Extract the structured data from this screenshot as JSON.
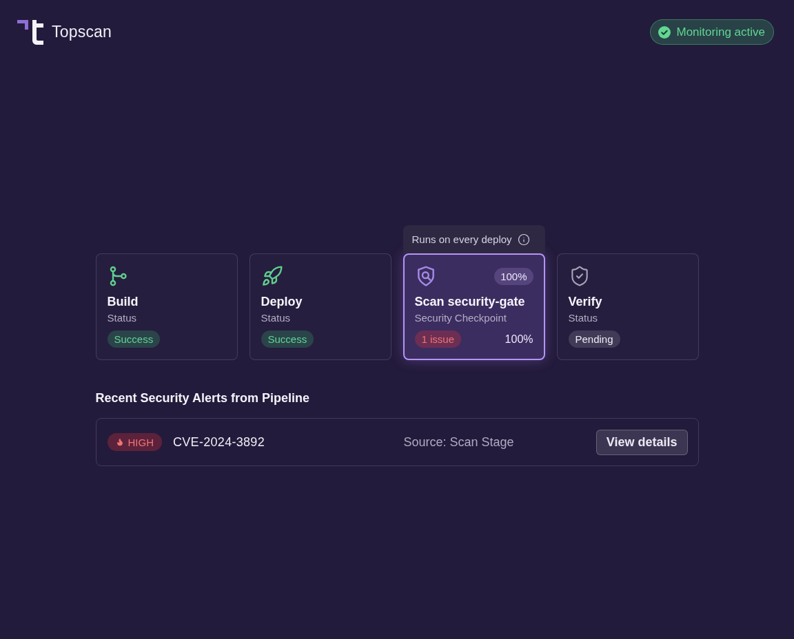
{
  "header": {
    "brand": "Topscan",
    "status": {
      "label": "Monitoring active",
      "kind": "success"
    }
  },
  "pipeline": {
    "stages": [
      {
        "kind": "build",
        "title": "Build",
        "subtitle": "Status",
        "badge": {
          "label": "Success",
          "kind": "success"
        },
        "selected": false
      },
      {
        "kind": "deploy",
        "title": "Deploy",
        "subtitle": "Status",
        "badge": {
          "label": "Success",
          "kind": "success"
        },
        "selected": false
      },
      {
        "kind": "scan",
        "tooltip": "Runs on every deploy",
        "progress_badge": "100%",
        "title": "Scan security-gate",
        "subtitle": "Security Checkpoint",
        "badge": {
          "label": "1 issue",
          "kind": "danger"
        },
        "progress_text": "100%",
        "selected": true
      },
      {
        "kind": "verify",
        "title": "Verify",
        "subtitle": "Status",
        "badge": {
          "label": "Pending",
          "kind": "pending"
        },
        "selected": false
      }
    ]
  },
  "alerts": {
    "title": "Recent Security Alerts from Pipeline",
    "items": [
      {
        "severity": {
          "label": "HIGH",
          "kind": "high"
        },
        "id": "CVE-2024-3892",
        "source": "Source: Scan Stage",
        "action": "View details"
      }
    ]
  }
}
